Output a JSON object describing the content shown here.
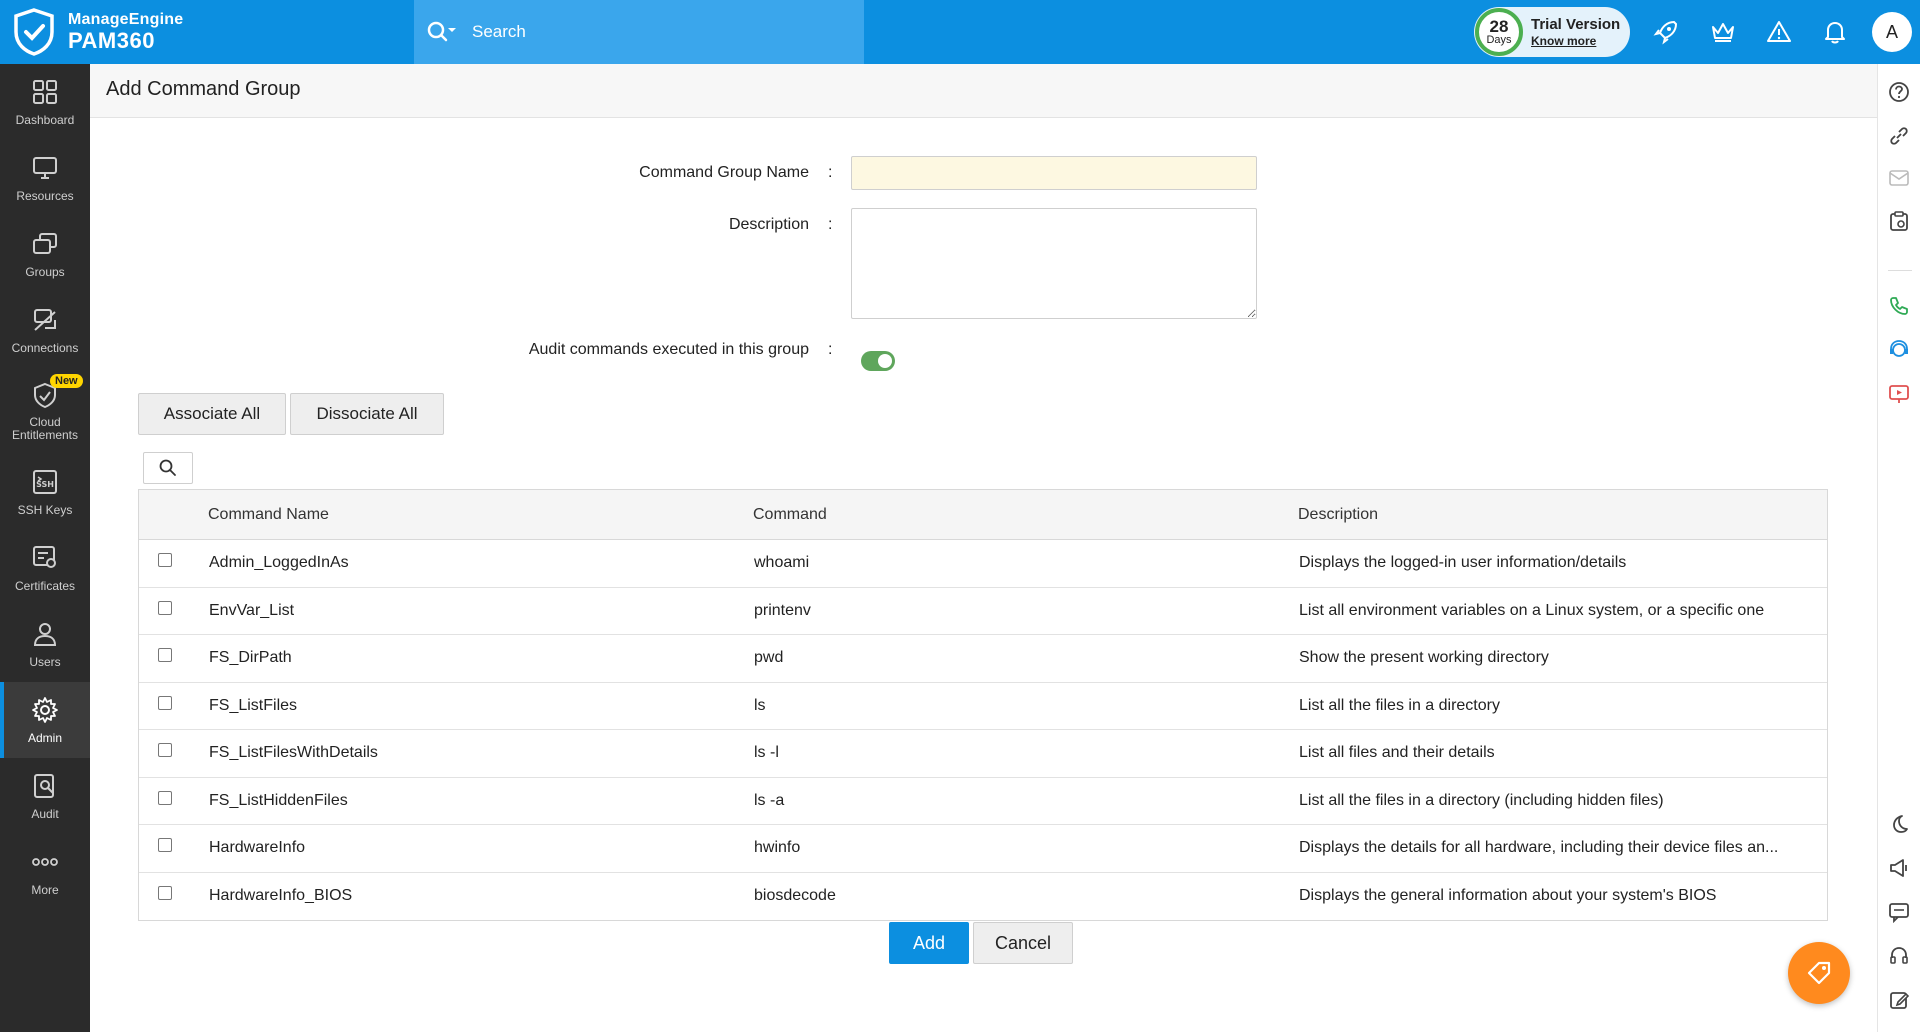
{
  "app": {
    "brand_line1": "ManageEngine",
    "brand_line2": "PAM360",
    "search_placeholder": "Search",
    "trial": {
      "days_number": "28",
      "days_label": "Days",
      "title": "Trial Version",
      "link": "Know more"
    },
    "avatar_initial": "A",
    "accent_color": "#0c8fe0"
  },
  "sidebar": {
    "items": [
      {
        "label": "Dashboard",
        "icon": "dashboard-icon"
      },
      {
        "label": "Resources",
        "icon": "monitor-icon"
      },
      {
        "label": "Groups",
        "icon": "groups-icon"
      },
      {
        "label": "Connections",
        "icon": "connections-icon"
      },
      {
        "label": "Cloud Entitlements",
        "icon": "cloud-shield-icon",
        "badge": "New"
      },
      {
        "label": "SSH Keys",
        "icon": "ssh-key-icon"
      },
      {
        "label": "Certificates",
        "icon": "certificate-icon"
      },
      {
        "label": "Users",
        "icon": "user-icon"
      },
      {
        "label": "Admin",
        "icon": "gear-icon",
        "active": true
      },
      {
        "label": "Audit",
        "icon": "audit-icon"
      },
      {
        "label": "More",
        "icon": "more-icon"
      }
    ]
  },
  "page": {
    "title": "Add Command Group",
    "form": {
      "name_label": "Command Group Name",
      "name_value": "",
      "desc_label": "Description",
      "desc_value": "",
      "audit_label": "Audit commands executed in this group",
      "audit_enabled": true,
      "colon": ":"
    },
    "associate_all": "Associate All",
    "dissociate_all": "Dissociate All",
    "table": {
      "columns": [
        "Command Name",
        "Command",
        "Description"
      ],
      "rows": [
        {
          "name": "Admin_LoggedInAs",
          "command": "whoami",
          "description": "Displays the logged-in user information/details"
        },
        {
          "name": "EnvVar_List",
          "command": "printenv",
          "description": "List all environment variables on a Linux system, or a specific one"
        },
        {
          "name": "FS_DirPath",
          "command": "pwd",
          "description": "Show the present working directory"
        },
        {
          "name": "FS_ListFiles",
          "command": "ls",
          "description": "List all the files in a directory"
        },
        {
          "name": "FS_ListFilesWithDetails",
          "command": "ls -l",
          "description": "List all files and their details"
        },
        {
          "name": "FS_ListHiddenFiles",
          "command": "ls -a",
          "description": "List all the files in a directory (including hidden files)"
        },
        {
          "name": "HardwareInfo",
          "command": "hwinfo",
          "description": "Displays the details for all hardware, including their device files an..."
        },
        {
          "name": "HardwareInfo_BIOS",
          "command": "biosdecode",
          "description": "Displays the general information about your system's BIOS"
        }
      ]
    },
    "add_label": "Add",
    "cancel_label": "Cancel"
  }
}
